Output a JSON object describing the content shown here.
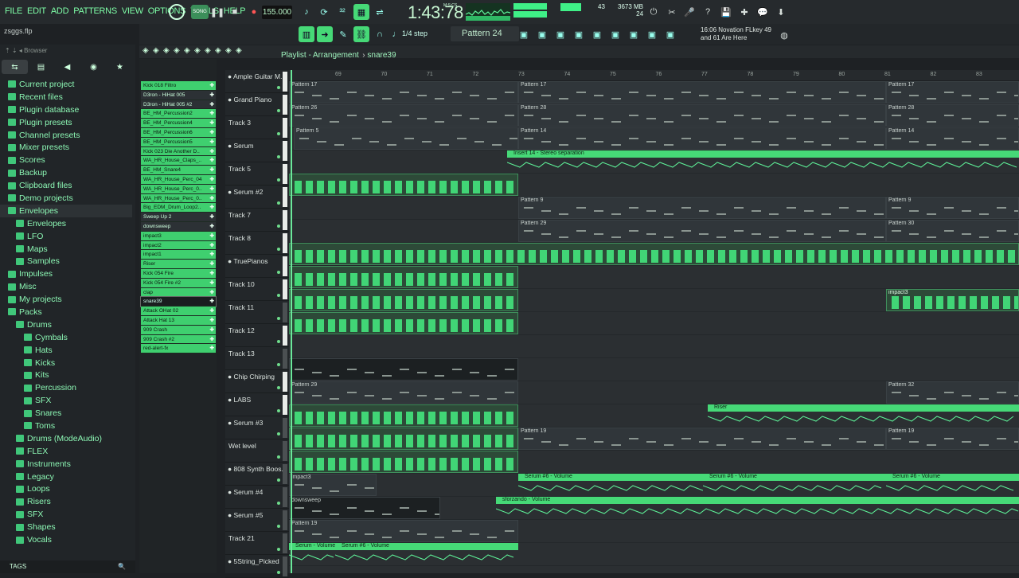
{
  "menu": [
    "FILE",
    "EDIT",
    "ADD",
    "PATTERNS",
    "VIEW",
    "OPTIONS",
    "TOOLS",
    "HELP"
  ],
  "file_name": "zsggs.flp",
  "transport": {
    "mode": "SONG",
    "tempo": "155.000",
    "time": "1:43:78",
    "time_unit": "M:S:CS"
  },
  "cpu": {
    "memory": "3673 MB",
    "polyphony": "24",
    "cpu_value": "43"
  },
  "toolbar": {
    "snap": "1/4 step",
    "pattern": "Pattern 24"
  },
  "hint": {
    "line1_time": "16:06",
    "line1_text": "Novation FLkey 49",
    "line2": "and 61 Are Here"
  },
  "browser": {
    "title": "Browser",
    "tags_label": "TAGS",
    "items": [
      {
        "label": "Current project",
        "depth": 0
      },
      {
        "label": "Recent files",
        "depth": 0
      },
      {
        "label": "Plugin database",
        "depth": 0
      },
      {
        "label": "Plugin presets",
        "depth": 0
      },
      {
        "label": "Channel presets",
        "depth": 0
      },
      {
        "label": "Mixer presets",
        "depth": 0
      },
      {
        "label": "Scores",
        "depth": 0
      },
      {
        "label": "Backup",
        "depth": 0
      },
      {
        "label": "Clipboard files",
        "depth": 0
      },
      {
        "label": "Demo projects",
        "depth": 0
      },
      {
        "label": "Envelopes",
        "depth": 0,
        "selected": true
      },
      {
        "label": "Envelopes",
        "depth": 1
      },
      {
        "label": "LFO",
        "depth": 1
      },
      {
        "label": "Maps",
        "depth": 1
      },
      {
        "label": "Samples",
        "depth": 1
      },
      {
        "label": "Impulses",
        "depth": 0
      },
      {
        "label": "Misc",
        "depth": 0
      },
      {
        "label": "My projects",
        "depth": 0
      },
      {
        "label": "Packs",
        "depth": 0
      },
      {
        "label": "Drums",
        "depth": 1
      },
      {
        "label": "Cymbals",
        "depth": 2
      },
      {
        "label": "Hats",
        "depth": 2
      },
      {
        "label": "Kicks",
        "depth": 2
      },
      {
        "label": "Kits",
        "depth": 2
      },
      {
        "label": "Percussion",
        "depth": 2
      },
      {
        "label": "SFX",
        "depth": 2
      },
      {
        "label": "Snares",
        "depth": 2
      },
      {
        "label": "Toms",
        "depth": 2
      },
      {
        "label": "Drums (ModeAudio)",
        "depth": 1
      },
      {
        "label": "FLEX",
        "depth": 1
      },
      {
        "label": "Instruments",
        "depth": 1
      },
      {
        "label": "Legacy",
        "depth": 1
      },
      {
        "label": "Loops",
        "depth": 1
      },
      {
        "label": "Risers",
        "depth": 1
      },
      {
        "label": "SFX",
        "depth": 1
      },
      {
        "label": "Shapes",
        "depth": 1
      },
      {
        "label": "Vocals",
        "depth": 1
      }
    ]
  },
  "channels": [
    {
      "label": "Kick 018 Filtro",
      "style": "green"
    },
    {
      "label": "D3ron - HiHat 005",
      "style": "dark"
    },
    {
      "label": "D3ron - HiHat 005 #2",
      "style": "dark"
    },
    {
      "label": "BE_HM_Percussion2",
      "style": "green"
    },
    {
      "label": "BE_HM_Percussion4",
      "style": "green"
    },
    {
      "label": "BE_HM_Percussion6",
      "style": "green"
    },
    {
      "label": "BE_HM_Percussion5",
      "style": "green"
    },
    {
      "label": "Kick 023 Die Another D..",
      "style": "green"
    },
    {
      "label": "WA_HR_House_Claps_..",
      "style": "green"
    },
    {
      "label": "BE_HM_Snare4",
      "style": "green"
    },
    {
      "label": "WA_HR_House_Perc_04",
      "style": "green"
    },
    {
      "label": "WA_HR_House_Perc_0..",
      "style": "green"
    },
    {
      "label": "WA_HR_House_Perc_0..",
      "style": "green"
    },
    {
      "label": "Big_EDM_Drum_Loop2..",
      "style": "green"
    },
    {
      "label": "Sweep Up 2",
      "style": "dark"
    },
    {
      "label": "downsweep",
      "style": "dark"
    },
    {
      "label": "impact3",
      "style": "green"
    },
    {
      "label": "impact2",
      "style": "green"
    },
    {
      "label": "impact1",
      "style": "green"
    },
    {
      "label": "Riser",
      "style": "green"
    },
    {
      "label": "Kick 054 Fire",
      "style": "green"
    },
    {
      "label": "Kick 054 Fire #2",
      "style": "green"
    },
    {
      "label": "clap",
      "style": "green"
    },
    {
      "label": "snare39",
      "style": "sel"
    },
    {
      "label": "Attack OHat 02",
      "style": "green"
    },
    {
      "label": "Attack Hat 13",
      "style": "green"
    },
    {
      "label": "909 Crash",
      "style": "green"
    },
    {
      "label": "909 Crash #2",
      "style": "green"
    },
    {
      "label": "red-alert-fx",
      "style": "green"
    }
  ],
  "playlist": {
    "title": "Playlist - Arrangement",
    "pattern": "snare39"
  },
  "ruler": [
    "69",
    "70",
    "71",
    "72",
    "73",
    "74",
    "75",
    "76",
    "77",
    "78",
    "79",
    "80",
    "81",
    "82",
    "83"
  ],
  "tracks": [
    {
      "name": "Ample Guitar M..",
      "dot": true
    },
    {
      "name": "Grand Piano",
      "dot": true
    },
    {
      "name": "Track 3",
      "dot": false
    },
    {
      "name": "Serum",
      "dot": true
    },
    {
      "name": "Track 5",
      "dot": false
    },
    {
      "name": "Serum #2",
      "dot": true
    },
    {
      "name": "Track 7",
      "dot": false
    },
    {
      "name": "Track 8",
      "dot": false
    },
    {
      "name": "TruePianos",
      "dot": true
    },
    {
      "name": "Track 10",
      "dot": false
    },
    {
      "name": "Track 11",
      "dot": false
    },
    {
      "name": "Track 12",
      "dot": false
    },
    {
      "name": "Track 13",
      "dot": false
    },
    {
      "name": "Chip Chirping",
      "dot": true
    },
    {
      "name": "LABS",
      "dot": true
    },
    {
      "name": "Serum #3",
      "dot": true
    },
    {
      "name": "Wet level",
      "dot": false
    },
    {
      "name": "808 Synth Boos..",
      "dot": true
    },
    {
      "name": "Serum #4",
      "dot": true
    },
    {
      "name": "Serum #5",
      "dot": true
    },
    {
      "name": "Track 21",
      "dot": false
    },
    {
      "name": "5String_Picked",
      "dot": true
    }
  ],
  "clips": [
    {
      "lane": 0,
      "label": "Pattern 17",
      "from": 0,
      "to": 288,
      "kind": "pattern"
    },
    {
      "lane": 0,
      "label": "Pattern 17",
      "from": 288,
      "to": 750,
      "kind": "pattern"
    },
    {
      "lane": 0,
      "label": "Pattern 17",
      "from": 750,
      "to": 917,
      "kind": "pattern"
    },
    {
      "lane": 1,
      "label": "Pattern 26",
      "from": 0,
      "to": 288,
      "kind": "pattern"
    },
    {
      "lane": 1,
      "label": "Pattern 28",
      "from": 288,
      "to": 750,
      "kind": "pattern"
    },
    {
      "lane": 1,
      "label": "Pattern 28",
      "from": 750,
      "to": 917,
      "kind": "pattern"
    },
    {
      "lane": 2,
      "label": "Pattern 5",
      "from": 6,
      "to": 288,
      "kind": "pattern"
    },
    {
      "lane": 2,
      "label": "Pattern 14",
      "from": 288,
      "to": 750,
      "kind": "pattern"
    },
    {
      "lane": 2,
      "label": "Pattern 14",
      "from": 750,
      "to": 917,
      "kind": "pattern"
    },
    {
      "lane": 3,
      "label": "Insert 14 - Stereo separation",
      "from": 274,
      "to": 917,
      "kind": "auto"
    },
    {
      "lane": 4,
      "label": "",
      "from": 0,
      "to": 288,
      "kind": "audio"
    },
    {
      "lane": 5,
      "label": "Pattern 9",
      "from": 288,
      "to": 750,
      "kind": "pattern"
    },
    {
      "lane": 5,
      "label": "Pattern 9",
      "from": 750,
      "to": 917,
      "kind": "pattern"
    },
    {
      "lane": 6,
      "label": "Pattern 29",
      "from": 288,
      "to": 750,
      "kind": "pattern"
    },
    {
      "lane": 6,
      "label": "Pattern 30",
      "from": 750,
      "to": 917,
      "kind": "pattern"
    },
    {
      "lane": 7,
      "label": "",
      "from": 0,
      "to": 917,
      "kind": "audio"
    },
    {
      "lane": 8,
      "label": "",
      "from": 0,
      "to": 288,
      "kind": "audio"
    },
    {
      "lane": 9,
      "label": "",
      "from": 0,
      "to": 288,
      "kind": "audio"
    },
    {
      "lane": 9,
      "label": "impact3",
      "from": 750,
      "to": 917,
      "kind": "audio"
    },
    {
      "lane": 10,
      "label": "",
      "from": 0,
      "to": 288,
      "kind": "audio"
    },
    {
      "lane": 12,
      "label": "",
      "from": 0,
      "to": 288,
      "kind": "dark"
    },
    {
      "lane": 13,
      "label": "Pattern 29",
      "from": 0,
      "to": 288,
      "kind": "pattern"
    },
    {
      "lane": 13,
      "label": "Pattern 32",
      "from": 750,
      "to": 917,
      "kind": "pattern"
    },
    {
      "lane": 14,
      "label": "",
      "from": 0,
      "to": 288,
      "kind": "audio"
    },
    {
      "lane": 14,
      "label": "Riser",
      "from": 526,
      "to": 917,
      "kind": "auto"
    },
    {
      "lane": 15,
      "label": "",
      "from": 0,
      "to": 288,
      "kind": "audio"
    },
    {
      "lane": 15,
      "label": "Pattern 19",
      "from": 288,
      "to": 750,
      "kind": "pattern"
    },
    {
      "lane": 15,
      "label": "Pattern 19",
      "from": 750,
      "to": 917,
      "kind": "pattern"
    },
    {
      "lane": 16,
      "label": "",
      "from": 0,
      "to": 288,
      "kind": "audio"
    },
    {
      "lane": 17,
      "label": "impact3",
      "from": 0,
      "to": 110,
      "kind": "pattern"
    },
    {
      "lane": 17,
      "label": "Serum #6 - Volume",
      "from": 288,
      "to": 520,
      "kind": "auto"
    },
    {
      "lane": 17,
      "label": "Serum #6 - Volume",
      "from": 520,
      "to": 750,
      "kind": "auto"
    },
    {
      "lane": 17,
      "label": "Serum #6 - Volume",
      "from": 750,
      "to": 917,
      "kind": "auto"
    },
    {
      "lane": 18,
      "label": "downsweep",
      "from": 0,
      "to": 190,
      "kind": "dark"
    },
    {
      "lane": 18,
      "label": "sforzando - Volume",
      "from": 260,
      "to": 917,
      "kind": "auto"
    },
    {
      "lane": 19,
      "label": "Pattern 19",
      "from": 0,
      "to": 288,
      "kind": "pattern"
    },
    {
      "lane": 20,
      "label": "Serum - Volume",
      "from": 0,
      "to": 58,
      "kind": "auto"
    },
    {
      "lane": 20,
      "label": "Serum #6 - Volume",
      "from": 58,
      "to": 288,
      "kind": "auto"
    }
  ]
}
